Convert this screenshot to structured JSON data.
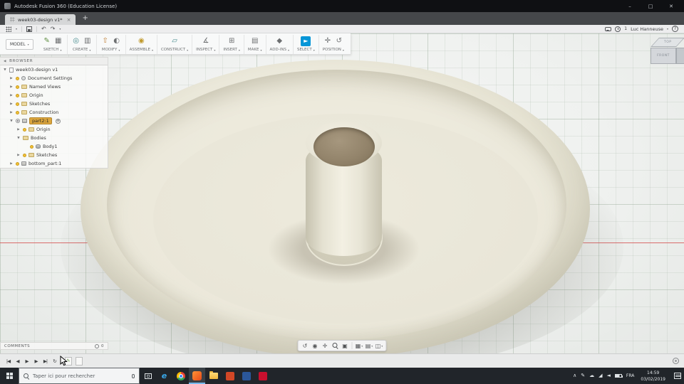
{
  "colors": {
    "fusion_blue": "#0696d7",
    "browser_highlight": "#dca63e",
    "bowl_cream": "#e9e6d7",
    "insert_tan": "#93846b",
    "axis_red": "#d44b4b"
  },
  "window": {
    "title": "Autodesk Fusion 360 (Education License)",
    "minimize": "–",
    "maximize": "□",
    "close": "✕"
  },
  "tabbar": {
    "active_tab": "week03-design v1*",
    "tab_close": "×",
    "new_tab": "+"
  },
  "qat": {
    "undo": "↶",
    "redo": "↷",
    "caret": "▾",
    "job_count": "1",
    "user": "Luc Hanneuse",
    "help": "?"
  },
  "ribbon": {
    "workspace": "MODEL",
    "caret": "▾",
    "groups": [
      {
        "label": "SKETCH",
        "icons": [
          "✎",
          "▦"
        ]
      },
      {
        "label": "CREATE",
        "icons": [
          "◎",
          "▥"
        ]
      },
      {
        "label": "MODIFY",
        "icons": [
          "⇧",
          "◐"
        ]
      },
      {
        "label": "ASSEMBLE",
        "icons": [
          "◉"
        ]
      },
      {
        "label": "CONSTRUCT",
        "icons": [
          "▱"
        ]
      },
      {
        "label": "INSPECT",
        "icons": [
          "∡"
        ]
      },
      {
        "label": "INSERT",
        "icons": [
          "⊞"
        ]
      },
      {
        "label": "MAKE",
        "icons": [
          "▤"
        ]
      },
      {
        "label": "ADD-INS",
        "icons": [
          "◆"
        ]
      },
      {
        "label": "SELECT",
        "icons": [
          "►"
        ]
      },
      {
        "label": "POSITION",
        "icons": [
          "✛",
          "↺"
        ]
      }
    ]
  },
  "browser": {
    "header": "BROWSER",
    "collapse": "◀",
    "items": [
      {
        "arrow": "▼",
        "label": "week03-design v1"
      },
      {
        "arrow": "▶",
        "label": "Document Settings"
      },
      {
        "arrow": "▶",
        "label": "Named Views"
      },
      {
        "arrow": "▶",
        "label": "Origin"
      },
      {
        "arrow": "▶",
        "label": "Sketches"
      },
      {
        "arrow": "▶",
        "label": "Construction"
      },
      {
        "arrow": "▼",
        "label": "part2:1",
        "badge": "⊕"
      },
      {
        "arrow": "▶",
        "label": "Origin"
      },
      {
        "arrow": "▼",
        "label": "Bodies"
      },
      {
        "arrow": "",
        "label": "Body1"
      },
      {
        "arrow": "▶",
        "label": "Sketches"
      },
      {
        "arrow": "▶",
        "label": "bottom_part:1"
      }
    ]
  },
  "viewcube": {
    "top": "TOP",
    "front": "FRONT"
  },
  "comments": {
    "label": "COMMENTS",
    "count": "0"
  },
  "navbar": {
    "orbit": "↺",
    "look_at": "◉",
    "pan": "✛",
    "fit": "▣",
    "display": "▦",
    "grid": "▤",
    "viewports": "◫",
    "caret": "▾"
  },
  "timeline": {
    "controls": [
      "|◀",
      "◀",
      "▶",
      "▶",
      "▶|",
      "↻"
    ],
    "feature_glyph": "✎"
  },
  "taskbar": {
    "search_placeholder": "Taper ici pour rechercher",
    "edge_glyph": "e"
  },
  "tray": {
    "chevron": "∧",
    "pen": "✎",
    "cloud": "☁",
    "network": "◢",
    "volume": "◄",
    "lang": "FRA",
    "time": "14:59",
    "date": "03/02/2019"
  }
}
